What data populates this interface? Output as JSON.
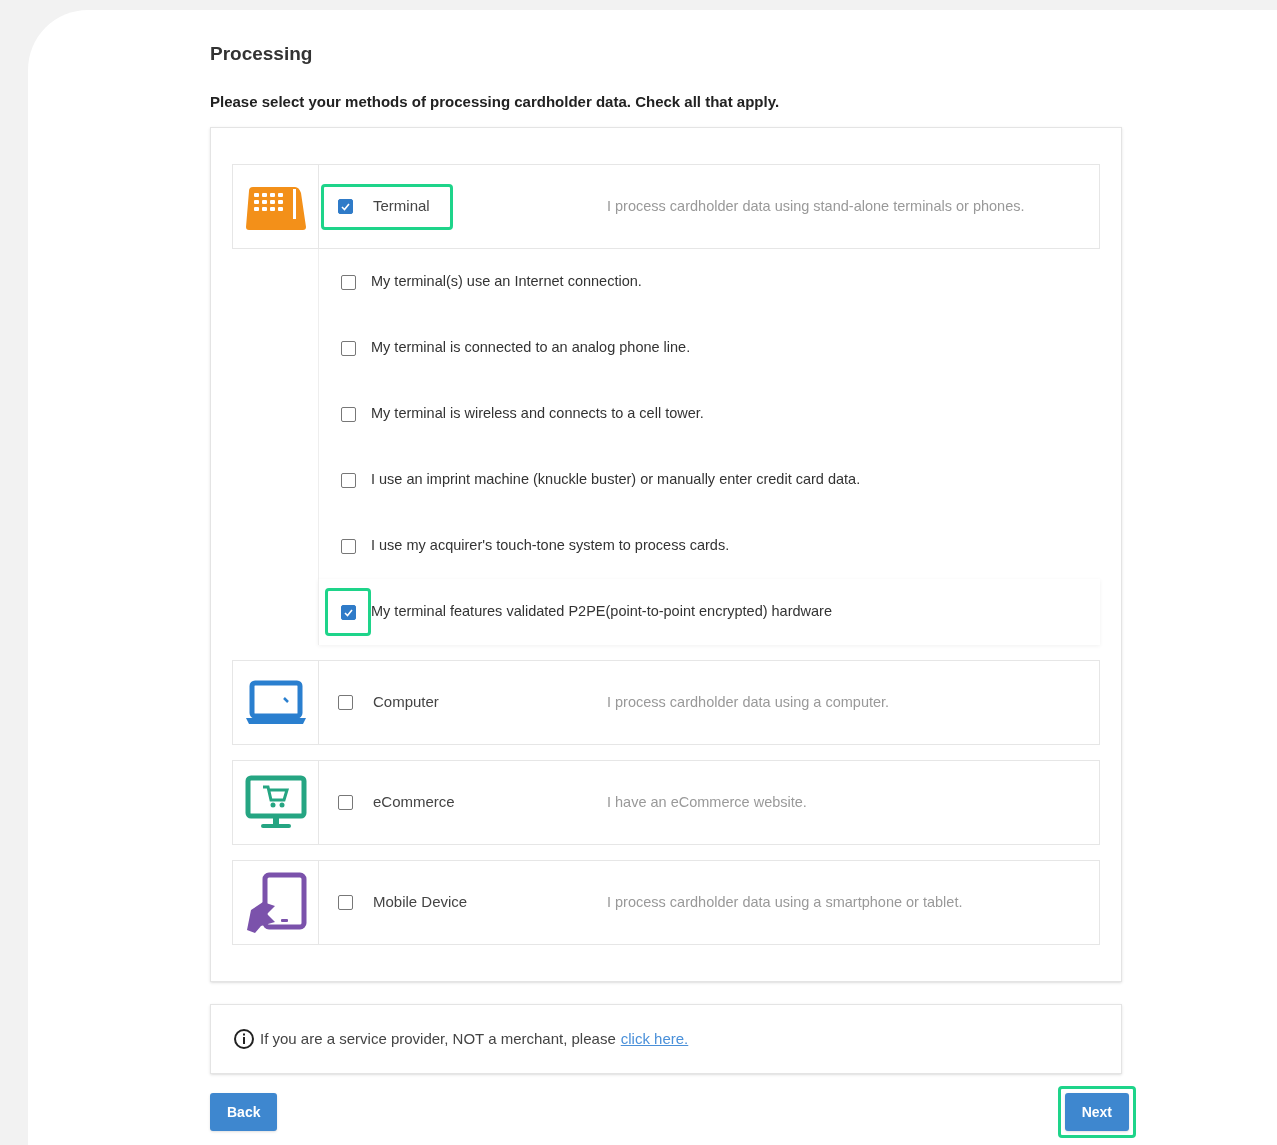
{
  "title": "Processing",
  "instruction": "Please select your methods of processing cardholder data. Check all that apply.",
  "categories": [
    {
      "kind": "phone",
      "label": "Terminal",
      "description": "I process cardholder data using stand-alone terminals or phones.",
      "checked": true,
      "highlighted": true,
      "options": [
        {
          "label": "My terminal(s) use an Internet connection.",
          "checked": false,
          "highlighted": false
        },
        {
          "label": "My terminal is connected to an analog phone line.",
          "checked": false,
          "highlighted": false
        },
        {
          "label": "My terminal is wireless and connects to a cell tower.",
          "checked": false,
          "highlighted": false
        },
        {
          "label": "I use an imprint machine (knuckle buster) or manually enter credit card data.",
          "checked": false,
          "highlighted": false
        },
        {
          "label": "I use my acquirer's touch-tone system to process cards.",
          "checked": false,
          "highlighted": false
        },
        {
          "label": "My terminal features validated P2PE(point-to-point encrypted) hardware",
          "checked": true,
          "highlighted": true
        }
      ]
    },
    {
      "kind": "laptop",
      "label": "Computer",
      "description": "I process cardholder data using a computer.",
      "checked": false,
      "highlighted": false
    },
    {
      "kind": "monitor-cart",
      "label": "eCommerce",
      "description": "I have an eCommerce website.",
      "checked": false,
      "highlighted": false
    },
    {
      "kind": "tablet-hand",
      "label": "Mobile Device",
      "description": "I process cardholder data using a smartphone or tablet.",
      "checked": false,
      "highlighted": false
    }
  ],
  "notice": {
    "text": "If you are a service provider, NOT a merchant, please",
    "link": "click here."
  },
  "buttons": [
    {
      "label": "Back",
      "highlighted": false
    },
    {
      "label": "Next",
      "highlighted": true
    }
  ]
}
